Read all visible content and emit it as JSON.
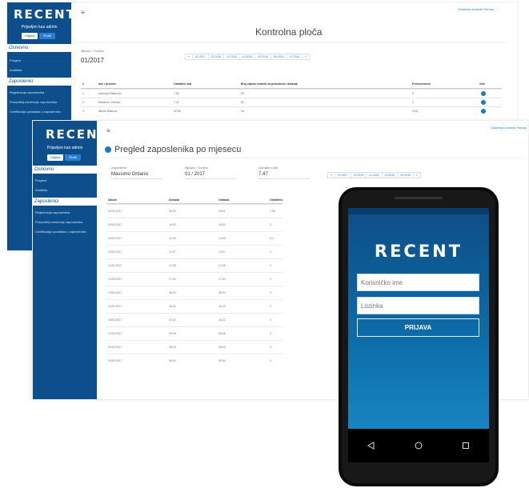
{
  "back": {
    "logo": "RECENT",
    "user": "Prijavljen kao admin",
    "btn_logout": "Odjava",
    "btn_profile": "Profil",
    "section1": "Osnovno",
    "links1": [
      "Pregled",
      "Analitika"
    ],
    "section2": "Zaposlenici",
    "links2": [
      "Registracija zaposlenika",
      "Posluzitelj evidencije zaposlenika",
      "Certifikacija podataka o zaposleniku"
    ],
    "top_link": "Odabrani korisnik Pardus",
    "title": "Kontrolna ploča",
    "period_label": "Mjesec / Godina",
    "period": "01/2017",
    "pager": [
      "«",
      "01.2017",
      "02.2016",
      "11.2016",
      "10.2016",
      "09.2016",
      "08.2016",
      "07.2016",
      "»"
    ],
    "table": {
      "headers": [
        "#",
        "Ime i prezime",
        "Odrađeni sati",
        "Broj zapisa vezanih za prisutnost i dolazak",
        "Prekovremeni",
        "Više"
      ],
      "rows": [
        [
          "1",
          "Antonija Klasnović",
          "7.50",
          "50",
          "0",
          ""
        ],
        [
          "2",
          "Massimo Orbanic",
          "7.47",
          "50",
          "0",
          ""
        ],
        [
          "3",
          "Nikola Radović",
          "32.56",
          "16",
          "3.06",
          ""
        ]
      ]
    }
  },
  "middle": {
    "logo": "RECENT",
    "user": "Prijavljen kao admin",
    "btn_logout": "Odjava",
    "btn_profile": "Profil",
    "section1": "Osnovno",
    "links1": [
      "Pregled",
      "Analitika"
    ],
    "section2": "Zaposlenici",
    "links2": [
      "Registracija zaposlenika",
      "Posluzitelj evidencije zaposlenika",
      "Certifikacija podataka o zaposleniku"
    ],
    "top_link": "Odabrani korisnik Pardus",
    "title": "Pregled zaposlenika po mjesecu",
    "fields": [
      {
        "label": "Zaposlenik",
        "value": "Massimo Orbanic"
      },
      {
        "label": "Mjesec / Godina",
        "value": "01 / 2017"
      },
      {
        "label": "Odrađeni sati",
        "value": "7.47"
      }
    ],
    "pager": [
      "«",
      "01.2017",
      "02.2016",
      "11.2016",
      "10.2016",
      "09.2016",
      "»"
    ],
    "table": {
      "headers": [
        "Datum",
        "Dolazak",
        "Odlazak",
        "Odrađeno"
      ],
      "rows": [
        [
          "02/01/2017",
          "08:00",
          "16:01",
          "7.98"
        ],
        [
          "03/01/2017",
          "16:00",
          "16:00",
          "0"
        ],
        [
          "04/01/2017",
          "14:00",
          "14:00",
          "0.1"
        ],
        [
          "10/01/2017",
          "14:07",
          "14:07",
          "0"
        ],
        [
          "11/01/2017",
          "12:26",
          "12:26",
          "0"
        ],
        [
          "12/01/2017",
          "17:54",
          "17:54",
          "0"
        ],
        [
          "13/01/2017",
          "08:30",
          "08:30",
          "0"
        ],
        [
          "16/01/2017",
          "18:42",
          "18:42",
          "0"
        ],
        [
          "18/01/2017",
          "16:22",
          "16:22",
          "0"
        ],
        [
          "19/01/2017",
          "08:06",
          "08:06",
          "0"
        ],
        [
          "20/01/2017",
          "08:00",
          "08:00",
          "0"
        ],
        [
          "23/01/2017",
          "08:00",
          "08:00",
          "0"
        ]
      ]
    }
  },
  "phone": {
    "logo": "RECENT",
    "username_placeholder": "Korisničko ime",
    "password_placeholder": "Lozinka",
    "login_label": "PRIJAVA",
    "nav_back": "◁",
    "nav_home": "○",
    "nav_recent": "□"
  }
}
